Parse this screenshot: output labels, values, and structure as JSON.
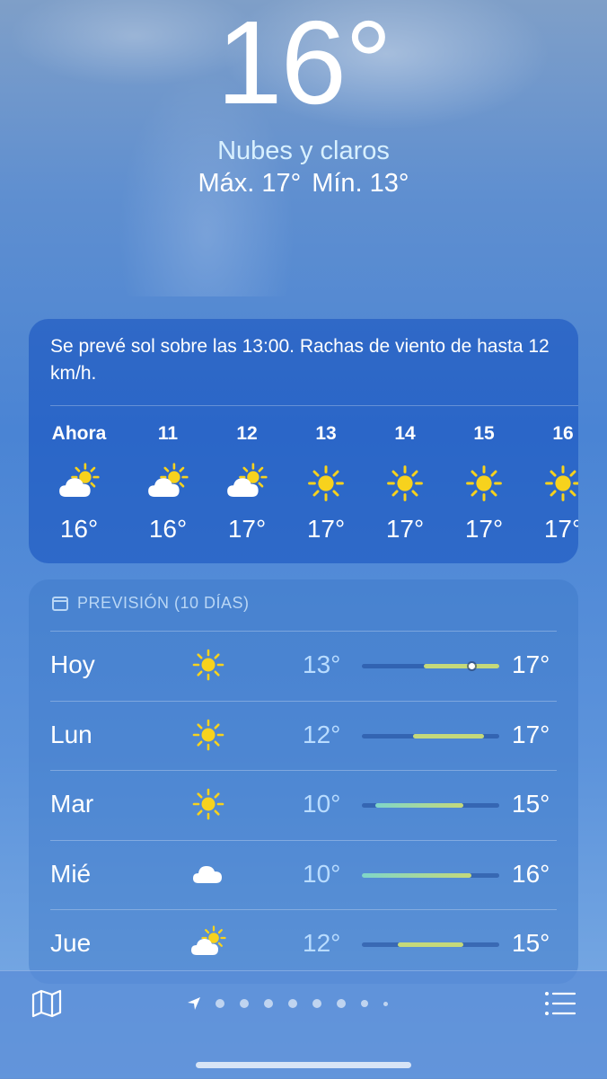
{
  "current": {
    "temperature": "16°",
    "condition": "Nubes y claros",
    "high": "Máx. 17°",
    "low": "Mín. 13°"
  },
  "hourly": {
    "summary": "Se prevé sol sobre las 13:00. Rachas de viento de hasta 12 km/h.",
    "hours": [
      {
        "label": "Ahora",
        "icon": "partly-sunny-icon",
        "temp": "16°"
      },
      {
        "label": "11",
        "icon": "partly-sunny-icon",
        "temp": "16°"
      },
      {
        "label": "12",
        "icon": "partly-sunny-icon",
        "temp": "17°"
      },
      {
        "label": "13",
        "icon": "sun-icon",
        "temp": "17°"
      },
      {
        "label": "14",
        "icon": "sun-icon",
        "temp": "17°"
      },
      {
        "label": "15",
        "icon": "sun-icon",
        "temp": "17°"
      },
      {
        "label": "16",
        "icon": "sun-icon",
        "temp": "17°"
      }
    ]
  },
  "daily": {
    "header": "PREVISIÓN (10 DÍAS)",
    "days": [
      {
        "name": "Hoy",
        "icon": "sun-icon",
        "min": "13°",
        "max": "17°",
        "bar_start": 0.45,
        "bar_end": 1.0,
        "current": 0.8
      },
      {
        "name": "Lun",
        "icon": "sun-icon",
        "min": "12°",
        "max": "17°",
        "bar_start": 0.37,
        "bar_end": 0.89
      },
      {
        "name": "Mar",
        "icon": "sun-icon",
        "min": "10°",
        "max": "15°",
        "bar_start": 0.1,
        "bar_end": 0.74
      },
      {
        "name": "Mié",
        "icon": "cloud-icon",
        "min": "10°",
        "max": "16°",
        "bar_start": 0.0,
        "bar_end": 0.8
      },
      {
        "name": "Jue",
        "icon": "partly-sunny-icon",
        "min": "12°",
        "max": "15°",
        "bar_start": 0.26,
        "bar_end": 0.74
      }
    ]
  },
  "colors": {
    "sun": "#f7d21d",
    "bar_warm": "#c5d97a",
    "bar_cool": "#7fd6c9"
  },
  "nav": {
    "map_icon": "map-icon",
    "list_icon": "list-icon",
    "location_icon": "location-arrow-icon",
    "page_count": 8
  }
}
